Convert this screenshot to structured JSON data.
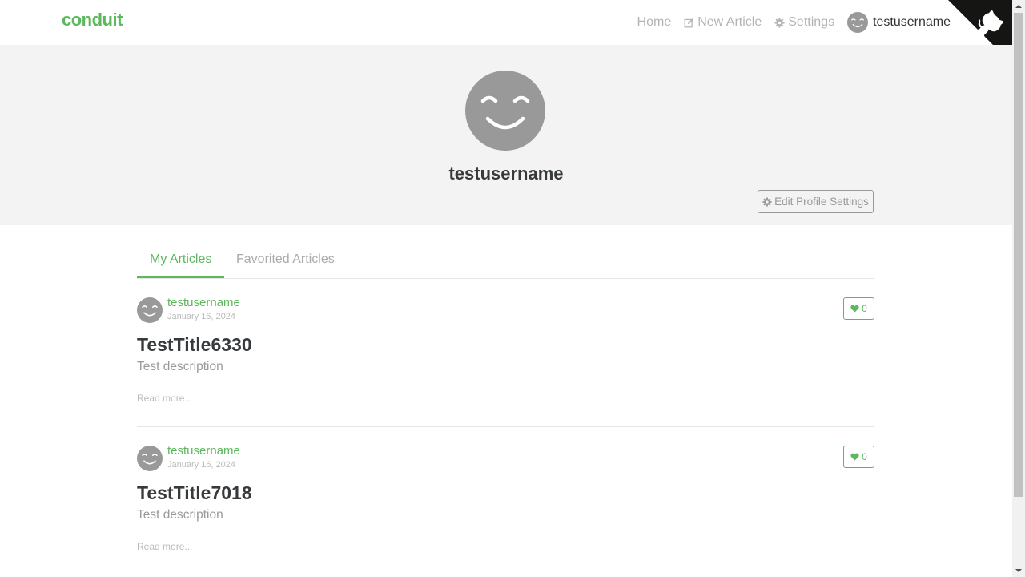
{
  "navbar": {
    "brand": "conduit",
    "links": {
      "home": "Home",
      "new_article": "New Article",
      "settings": "Settings",
      "username": "testusername"
    }
  },
  "profile": {
    "username": "testusername",
    "edit_button": "Edit Profile Settings"
  },
  "tabs": {
    "my_articles": "My Articles",
    "favorited_articles": "Favorited Articles"
  },
  "articles": [
    {
      "author": "testusername",
      "date": "January 16, 2024",
      "likes": "0",
      "title": "TestTitle6330",
      "description": "Test description",
      "read_more": "Read more..."
    },
    {
      "author": "testusername",
      "date": "January 16, 2024",
      "likes": "0",
      "title": "TestTitle7018",
      "description": "Test description",
      "read_more": "Read more..."
    }
  ],
  "colors": {
    "brand": "#5cb85c",
    "banner_bg": "#f3f3f3",
    "avatar_gray": "#999999"
  },
  "icons": {
    "new_article": "edit-icon",
    "settings": "gear-icon",
    "like": "heart-icon",
    "github": "github-octocat-icon"
  }
}
